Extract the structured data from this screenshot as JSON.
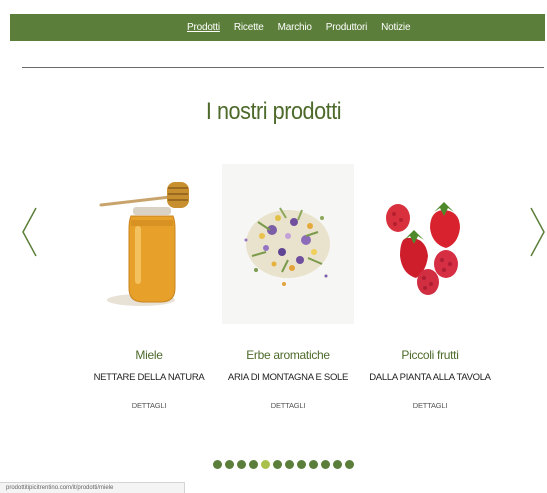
{
  "nav": {
    "items": [
      {
        "label": "Prodotti",
        "active": true
      },
      {
        "label": "Ricette",
        "active": false
      },
      {
        "label": "Marchio",
        "active": false
      },
      {
        "label": "Produttori",
        "active": false
      },
      {
        "label": "Notizie",
        "active": false
      }
    ]
  },
  "main": {
    "title": "I nostri prodotti",
    "carousel": {
      "prev_icon": "chevron-left-icon",
      "next_icon": "chevron-right-icon",
      "products": [
        {
          "name": "Miele",
          "subtitle": "NETTARE DELLA NATURA",
          "details": "DETTAGLI",
          "image": "honey-jar-icon"
        },
        {
          "name": "Erbe aromatiche",
          "subtitle": "ARIA DI MONTAGNA E SOLE",
          "details": "DETTAGLI",
          "image": "dried-herbs-icon"
        },
        {
          "name": "Piccoli frutti",
          "subtitle": "DALLA PIANTA ALLA TAVOLA",
          "details": "DETTAGLI",
          "image": "berries-icon"
        }
      ],
      "pagination": {
        "count": 12,
        "active_index": 4
      }
    }
  },
  "colors": {
    "brand_green": "#5b7f3a",
    "title_green": "#4d6a2b",
    "active_dot": "#a9c14a"
  },
  "status_bar": {
    "text": "prodottitipicitrentino.com/it/prodotti/miele"
  }
}
